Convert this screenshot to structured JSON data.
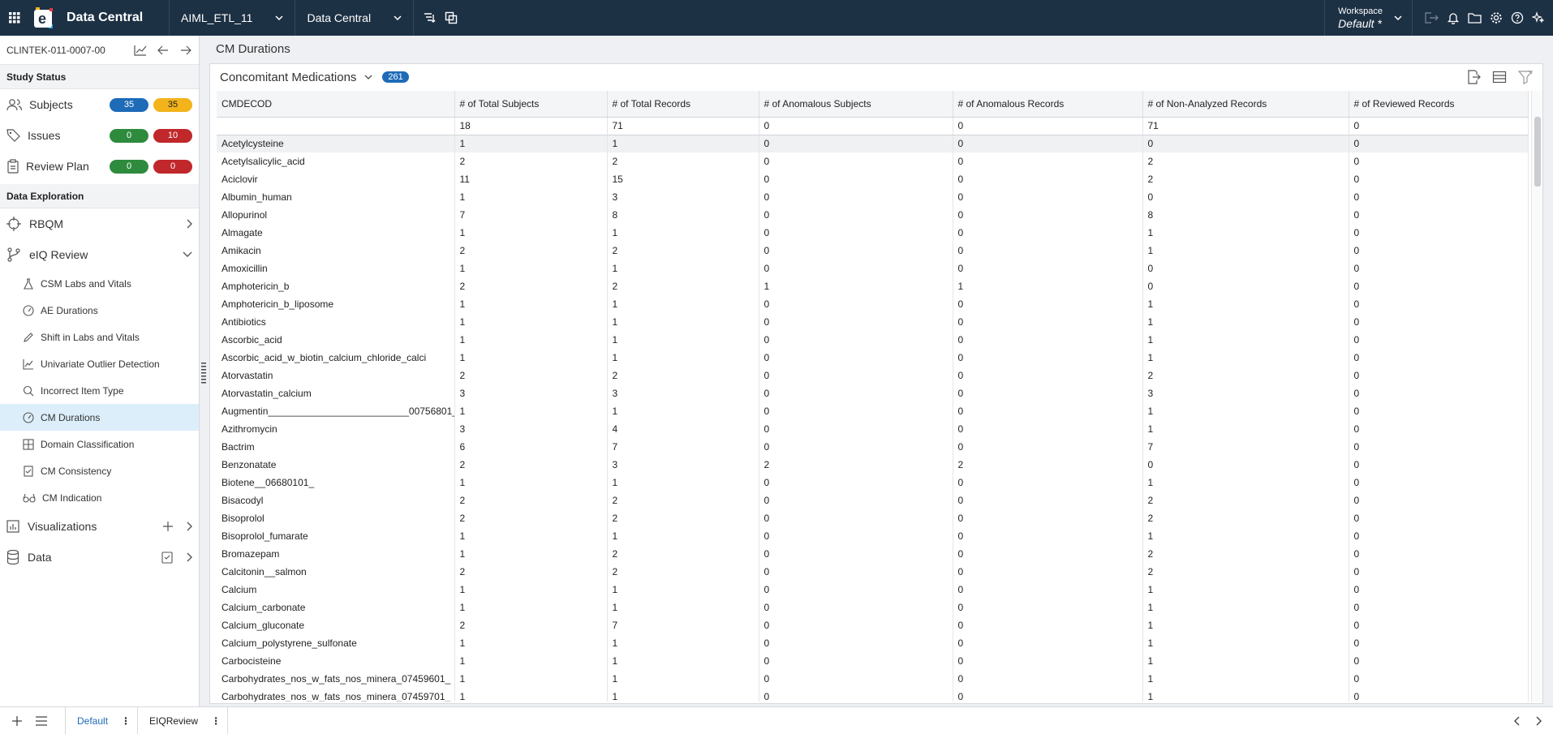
{
  "app": {
    "title": "Data Central",
    "study_selector": "AIML_ETL_11",
    "module_selector": "Data Central",
    "workspace_label": "Workspace",
    "workspace_value": "Default",
    "workspace_marker": "*"
  },
  "sidebar": {
    "study_id": "CLINTEK-011-0007-00",
    "study_status_heading": "Study Status",
    "status": [
      {
        "label": "Subjects",
        "a": "35",
        "b": "35"
      },
      {
        "label": "Issues",
        "a": "0",
        "b": "10"
      },
      {
        "label": "Review Plan",
        "a": "0",
        "b": "0"
      }
    ],
    "data_exploration_heading": "Data Exploration",
    "rbqm": "RBQM",
    "eiq_review": "eIQ Review",
    "sub_items": [
      "CSM Labs and Vitals",
      "AE Durations",
      "Shift in Labs and Vitals",
      "Univariate Outlier Detection",
      "Incorrect Item Type",
      "CM Durations",
      "Domain Classification",
      "CM Consistency",
      "CM Indication"
    ],
    "visualizations": "Visualizations",
    "data": "Data"
  },
  "main": {
    "breadcrumb": "CM Durations",
    "panel_title": "Concomitant Medications",
    "panel_count": "261",
    "columns": [
      "CMDECOD",
      "# of Total Subjects",
      "# of Total Records",
      "# of Anomalous Subjects",
      "# of Anomalous Records",
      "# of Non-Analyzed Records",
      "# of Reviewed Records"
    ],
    "totals": [
      "",
      "18",
      "71",
      "0",
      "0",
      "71",
      "0"
    ],
    "rows": [
      [
        "Acetylcysteine",
        "1",
        "1",
        "0",
        "0",
        "0",
        "0"
      ],
      [
        "Acetylsalicylic_acid",
        "2",
        "2",
        "0",
        "0",
        "2",
        "0"
      ],
      [
        "Aciclovir",
        "11",
        "15",
        "0",
        "0",
        "2",
        "0"
      ],
      [
        "Albumin_human",
        "1",
        "3",
        "0",
        "0",
        "0",
        "0"
      ],
      [
        "Allopurinol",
        "7",
        "8",
        "0",
        "0",
        "8",
        "0"
      ],
      [
        "Almagate",
        "1",
        "1",
        "0",
        "0",
        "1",
        "0"
      ],
      [
        "Amikacin",
        "2",
        "2",
        "0",
        "0",
        "1",
        "0"
      ],
      [
        "Amoxicillin",
        "1",
        "1",
        "0",
        "0",
        "0",
        "0"
      ],
      [
        "Amphotericin_b",
        "2",
        "2",
        "1",
        "1",
        "0",
        "0"
      ],
      [
        "Amphotericin_b_liposome",
        "1",
        "1",
        "0",
        "0",
        "1",
        "0"
      ],
      [
        "Antibiotics",
        "1",
        "1",
        "0",
        "0",
        "1",
        "0"
      ],
      [
        "Ascorbic_acid",
        "1",
        "1",
        "0",
        "0",
        "1",
        "0"
      ],
      [
        "Ascorbic_acid_w_biotin_calcium_chloride_calci",
        "1",
        "1",
        "0",
        "0",
        "1",
        "0"
      ],
      [
        "Atorvastatin",
        "2",
        "2",
        "0",
        "0",
        "2",
        "0"
      ],
      [
        "Atorvastatin_calcium",
        "3",
        "3",
        "0",
        "0",
        "3",
        "0"
      ],
      [
        "Augmentin__________________________00756801_",
        "1",
        "1",
        "0",
        "0",
        "1",
        "0"
      ],
      [
        "Azithromycin",
        "3",
        "4",
        "0",
        "0",
        "1",
        "0"
      ],
      [
        "Bactrim",
        "6",
        "7",
        "0",
        "0",
        "7",
        "0"
      ],
      [
        "Benzonatate",
        "2",
        "3",
        "2",
        "2",
        "0",
        "0"
      ],
      [
        "Biotene__06680101_",
        "1",
        "1",
        "0",
        "0",
        "1",
        "0"
      ],
      [
        "Bisacodyl",
        "2",
        "2",
        "0",
        "0",
        "2",
        "0"
      ],
      [
        "Bisoprolol",
        "2",
        "2",
        "0",
        "0",
        "2",
        "0"
      ],
      [
        "Bisoprolol_fumarate",
        "1",
        "1",
        "0",
        "0",
        "1",
        "0"
      ],
      [
        "Bromazepam",
        "1",
        "2",
        "0",
        "0",
        "2",
        "0"
      ],
      [
        "Calcitonin__salmon",
        "2",
        "2",
        "0",
        "0",
        "2",
        "0"
      ],
      [
        "Calcium",
        "1",
        "1",
        "0",
        "0",
        "1",
        "0"
      ],
      [
        "Calcium_carbonate",
        "1",
        "1",
        "0",
        "0",
        "1",
        "0"
      ],
      [
        "Calcium_gluconate",
        "2",
        "7",
        "0",
        "0",
        "1",
        "0"
      ],
      [
        "Calcium_polystyrene_sulfonate",
        "1",
        "1",
        "0",
        "0",
        "1",
        "0"
      ],
      [
        "Carbocisteine",
        "1",
        "1",
        "0",
        "0",
        "1",
        "0"
      ],
      [
        "Carbohydrates_nos_w_fats_nos_minera_07459601_",
        "1",
        "1",
        "0",
        "0",
        "1",
        "0"
      ],
      [
        "Carbohydrates_nos_w_fats_nos_minera_07459701_",
        "1",
        "1",
        "0",
        "0",
        "1",
        "0"
      ]
    ]
  },
  "bottom": {
    "tabs": [
      "Default",
      "EIQReview"
    ]
  }
}
